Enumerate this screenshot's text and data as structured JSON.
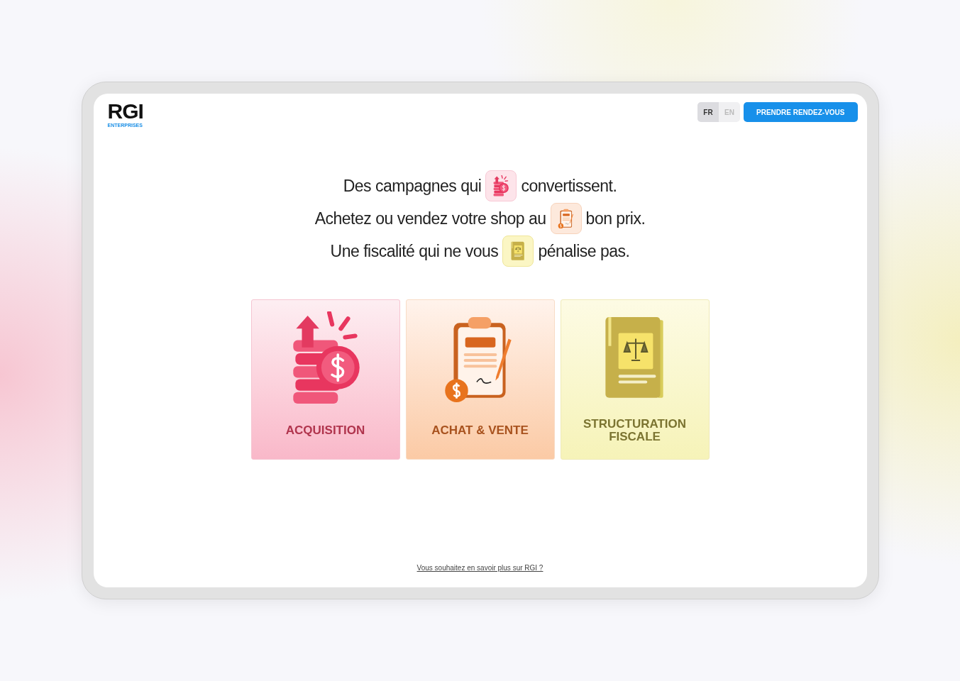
{
  "header": {
    "logo": {
      "wordmark": "RGI",
      "tagline": "ENTERPRISES"
    },
    "languages": [
      {
        "label": "FR",
        "selected": true
      },
      {
        "label": "EN",
        "selected": false
      }
    ],
    "cta_button": "PRENDRE RENDEZ-VOUS"
  },
  "headlines": [
    {
      "before": "Des campagnes qui",
      "kind": "coins",
      "after": "convertissent."
    },
    {
      "before": "Achetez ou vendez votre shop au",
      "kind": "clipboard",
      "after": "bon prix."
    },
    {
      "before": "Une fiscalité qui ne vous",
      "kind": "book",
      "after": "pénalise pas."
    }
  ],
  "cards": [
    {
      "kind": "coins",
      "title": "ACQUISITION"
    },
    {
      "kind": "clipboard",
      "title": "ACHAT & VENTE"
    },
    {
      "kind": "book",
      "title": "STRUCTURATION FISCALE"
    }
  ],
  "footer_link": "Vous souhaitez en savoir plus sur RGI ?"
}
